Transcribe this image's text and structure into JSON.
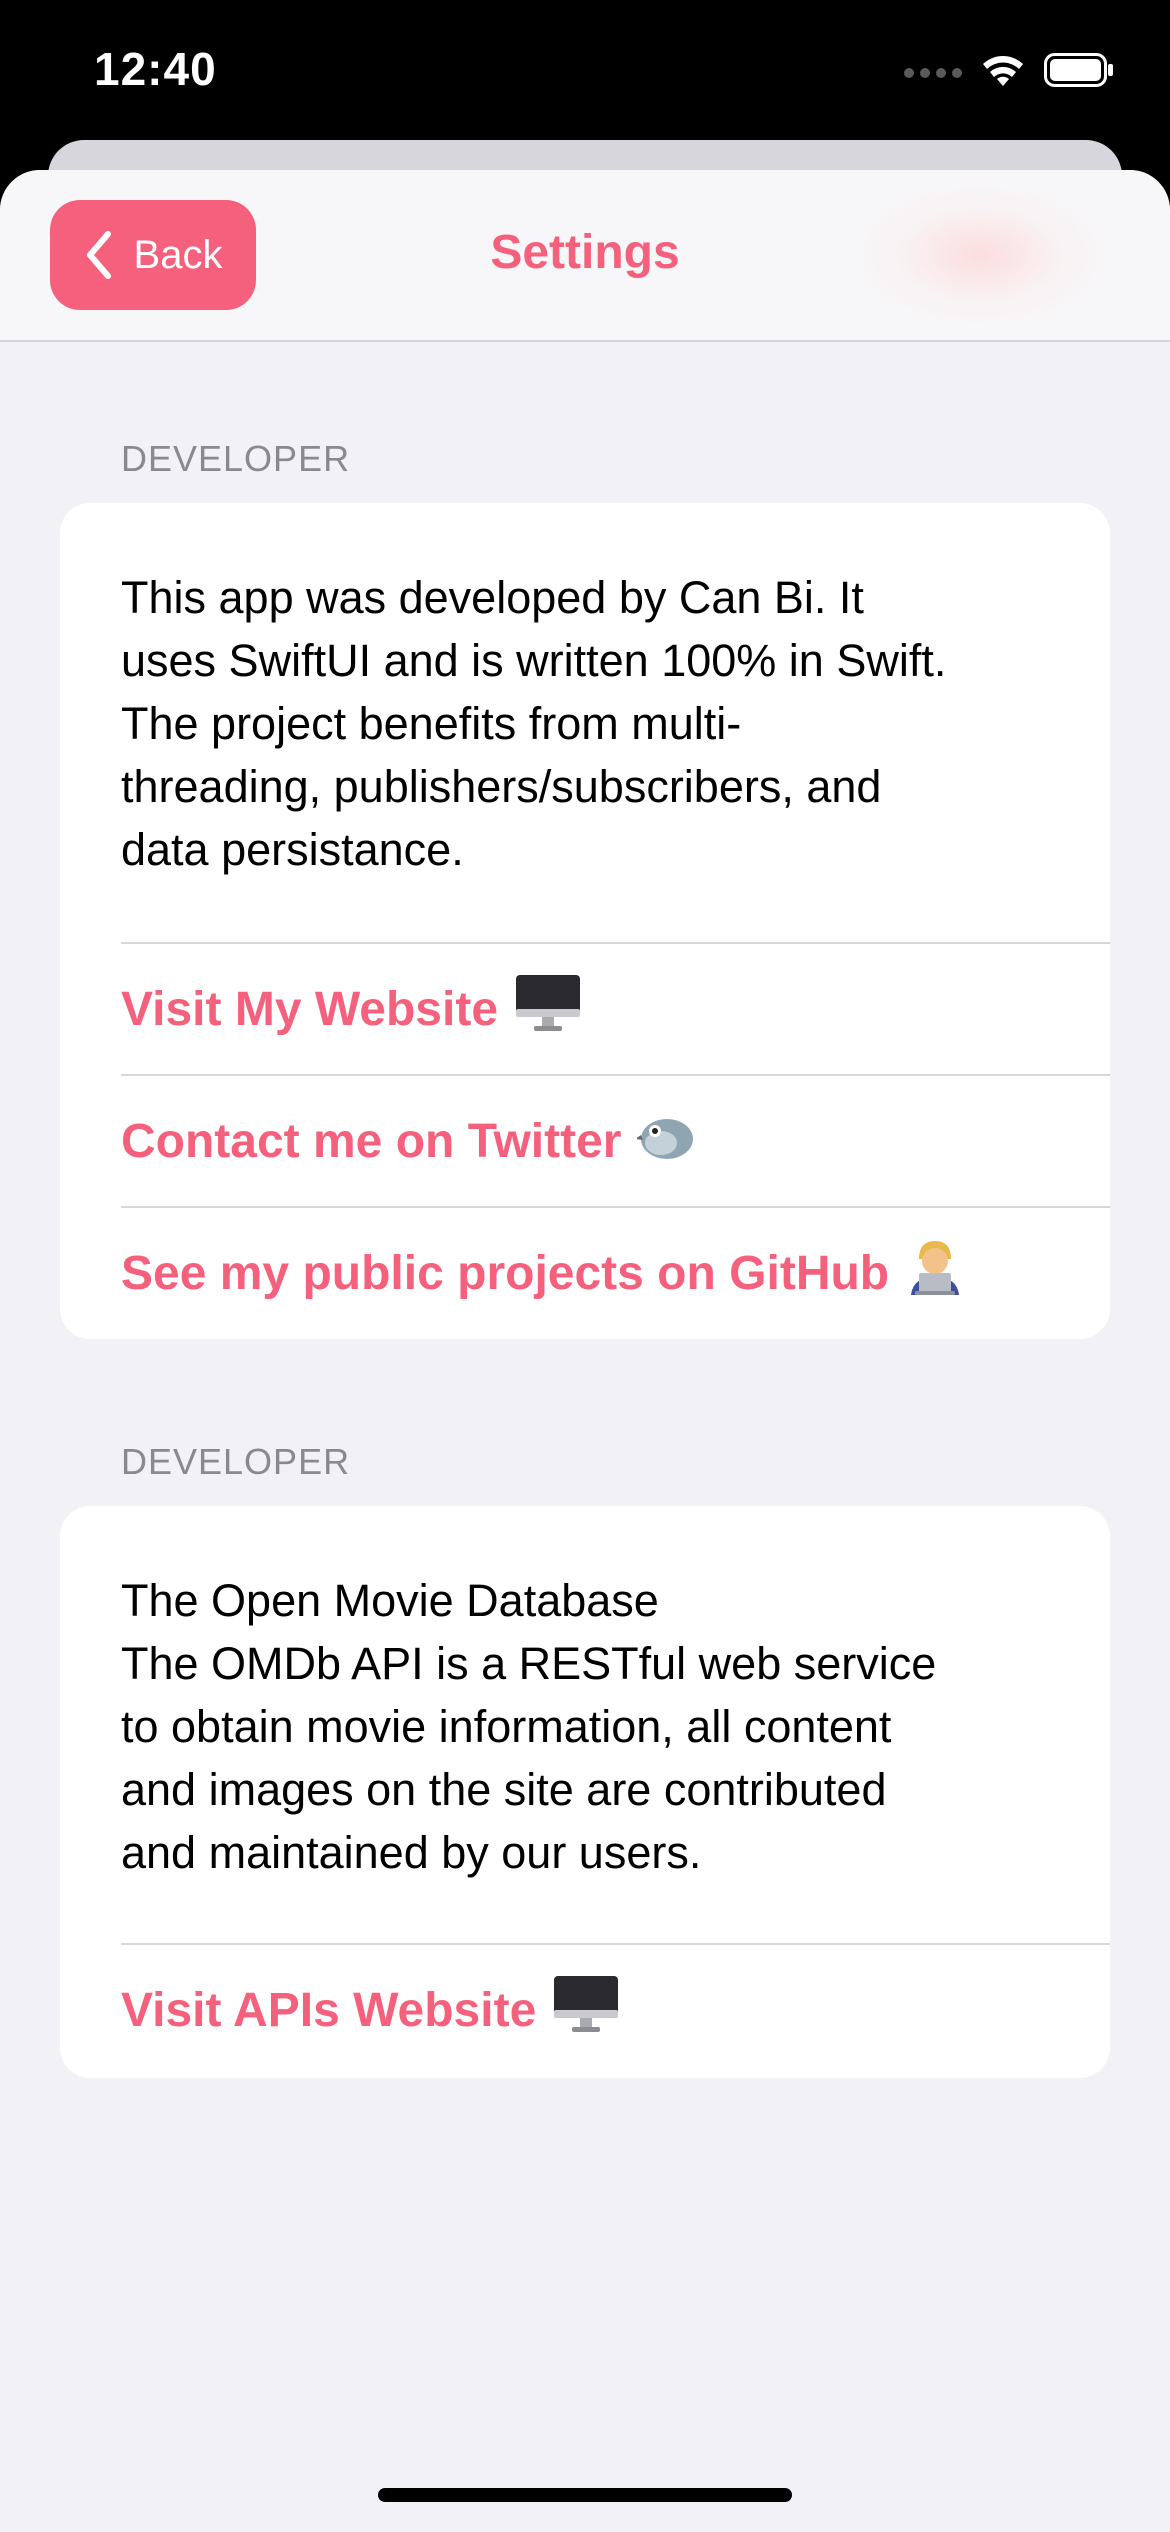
{
  "status_bar": {
    "time": "12:40"
  },
  "nav": {
    "back_label": "Back",
    "title": "Settings"
  },
  "sections": [
    {
      "header": "DEVELOPER",
      "body": "This app was developed by Can Bi. It\nuses SwiftUI and is written 100% in Swift.\nThe project benefits from multi-\nthreading, publishers/subscribers, and\ndata persistance.",
      "links": [
        {
          "label": "Visit My Website",
          "icon": "desktop-computer-icon"
        },
        {
          "label": "Contact me on Twitter",
          "icon": "bird-icon"
        },
        {
          "label": "See my public projects on GitHub",
          "icon": "technologist-icon"
        }
      ]
    },
    {
      "header": "DEVELOPER",
      "body": "The Open Movie Database\nThe OMDb API is a RESTful web service\nto obtain movie information, all content\nand images on the site are contributed\nand maintained by our users.",
      "links": [
        {
          "label": "Visit APIs Website",
          "icon": "desktop-computer-icon"
        }
      ]
    }
  ],
  "colors": {
    "accent": "#f5617d",
    "background": "#f1f1f6",
    "card": "#ffffff",
    "section_header": "#8a8a8e"
  }
}
